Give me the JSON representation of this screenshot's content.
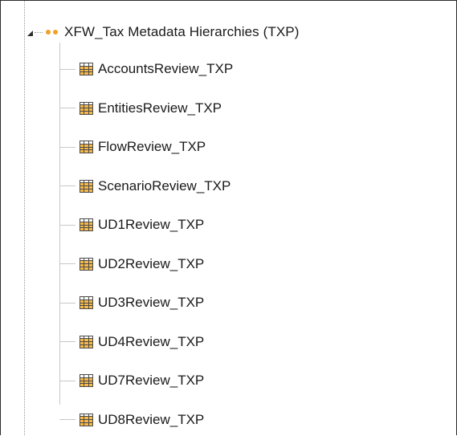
{
  "root": {
    "label": "XFW_Tax Metadata Hierarchies (TXP)",
    "expand_icon": "expanded-triangle-icon",
    "node_icon": "orange-dots-icon"
  },
  "children": [
    {
      "label": "AccountsReview_TXP"
    },
    {
      "label": "EntitiesReview_TXP"
    },
    {
      "label": "FlowReview_TXP"
    },
    {
      "label": "ScenarioReview_TXP"
    },
    {
      "label": "UD1Review_TXP"
    },
    {
      "label": "UD2Review_TXP"
    },
    {
      "label": "UD3Review_TXP"
    },
    {
      "label": "UD4Review_TXP"
    },
    {
      "label": "UD7Review_TXP"
    },
    {
      "label": "UD8Review_TXP"
    }
  ],
  "child_icon": "table-grid-icon",
  "colors": {
    "accent_orange": "#f0a126",
    "grid_fill": "#f6b94a",
    "border": "#2b2b2b",
    "tree_line": "#c8c8c8"
  }
}
